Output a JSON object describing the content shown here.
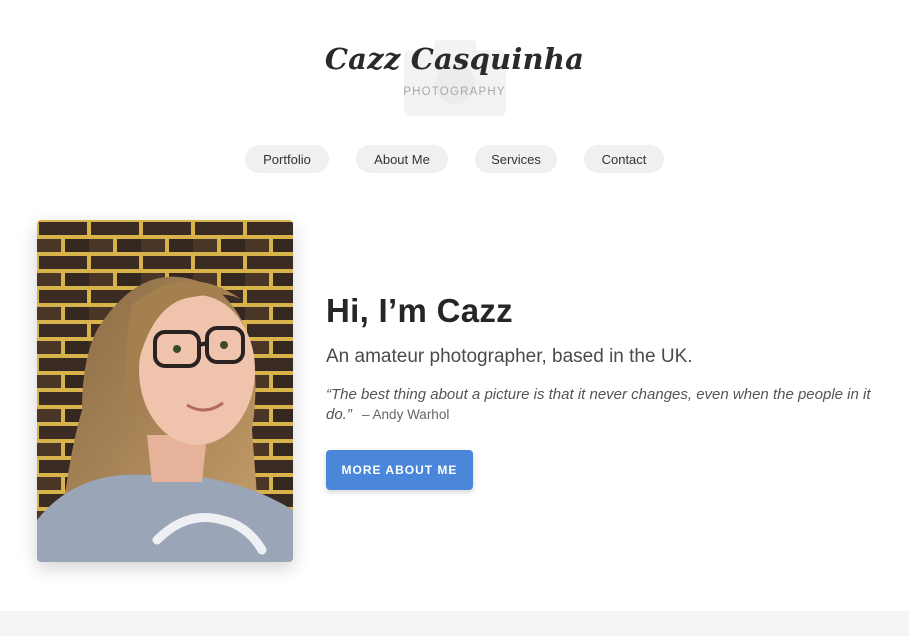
{
  "brand": {
    "title": "Cazz Casquinha",
    "subtitle": "PHOTOGRAPHY",
    "logo_icon": "camera-icon"
  },
  "nav": {
    "items": [
      {
        "label": "Portfolio"
      },
      {
        "label": "About Me"
      },
      {
        "label": "Services"
      },
      {
        "label": "Contact"
      }
    ]
  },
  "hero": {
    "heading": "Hi, I’m Cazz",
    "subheading": "An amateur photographer, based in the UK.",
    "quote": "“The best thing about a picture is that it never changes, even when the people in it do.”",
    "quote_author": "– Andy Warhol",
    "cta_label": "MORE ABOUT ME"
  },
  "colors": {
    "accent": "#4a86d9",
    "nav_pill": "#f0f0f0",
    "footer": "#f4f4f4"
  }
}
